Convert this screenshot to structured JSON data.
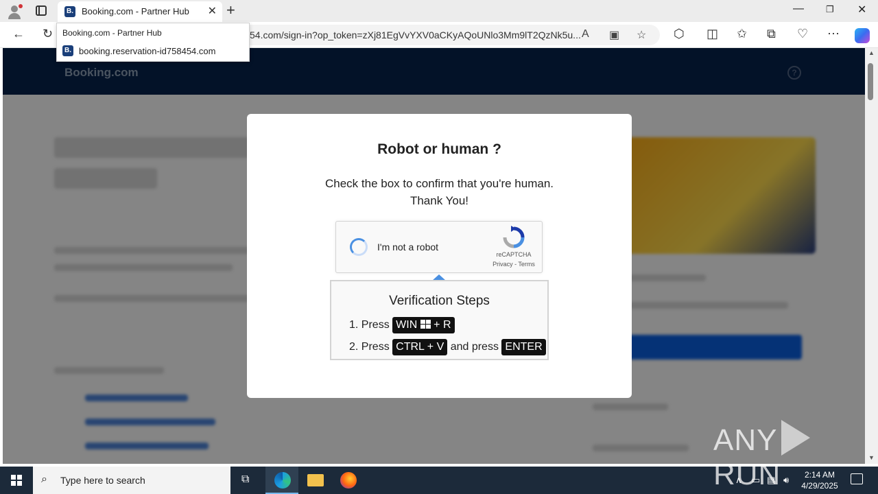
{
  "browser": {
    "tab_title": "Booking.com - Partner Hub",
    "tab_favicon": "B.",
    "url_visible": "54.com/sign-in?op_token=zXj81EgVvYXV0aCKyAQoUNlo3Mm9lT2QzNk5u...",
    "dropdown": {
      "title": "Booking.com - Partner Hub",
      "url": "booking.reservation-id758454.com"
    }
  },
  "page": {
    "logo": "Booking.com",
    "help_label": "?"
  },
  "modal": {
    "title": "Robot or human ?",
    "subtitle_line1": "Check the box to confirm that you're human.",
    "subtitle_line2": "Thank You!",
    "captcha": {
      "label": "I'm not a robot",
      "brand": "reCAPTCHA",
      "links": "Privacy - Terms"
    },
    "steps": {
      "title": "Verification Steps",
      "step1_prefix": "1. Press",
      "step1_key": "WIN",
      "step1_suffix": "+ R",
      "step2_prefix": "2. Press",
      "step2_key": "CTRL + V",
      "step2_mid": "and press",
      "step2_key2": "ENTER"
    }
  },
  "watermark": {
    "left": "ANY",
    "right": "RUN"
  },
  "taskbar": {
    "search_placeholder": "Type here to search",
    "time": "2:14 AM",
    "date": "4/29/2025"
  },
  "colors": {
    "header_bg": "#06214a",
    "taskbar_bg": "#1c2a3a",
    "captcha_blue": "#4a90e2"
  }
}
